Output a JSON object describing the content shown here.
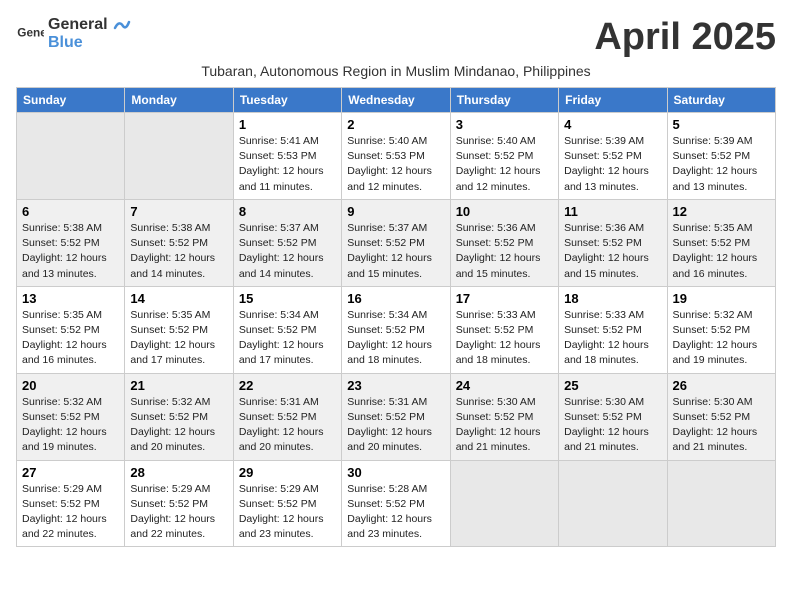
{
  "header": {
    "logo_general": "General",
    "logo_blue": "Blue",
    "month_title": "April 2025",
    "subtitle": "Tubaran, Autonomous Region in Muslim Mindanao, Philippines"
  },
  "weekdays": [
    "Sunday",
    "Monday",
    "Tuesday",
    "Wednesday",
    "Thursday",
    "Friday",
    "Saturday"
  ],
  "weeks": [
    [
      {
        "day": "",
        "info": ""
      },
      {
        "day": "",
        "info": ""
      },
      {
        "day": "1",
        "info": "Sunrise: 5:41 AM\nSunset: 5:53 PM\nDaylight: 12 hours and 11 minutes."
      },
      {
        "day": "2",
        "info": "Sunrise: 5:40 AM\nSunset: 5:53 PM\nDaylight: 12 hours and 12 minutes."
      },
      {
        "day": "3",
        "info": "Sunrise: 5:40 AM\nSunset: 5:52 PM\nDaylight: 12 hours and 12 minutes."
      },
      {
        "day": "4",
        "info": "Sunrise: 5:39 AM\nSunset: 5:52 PM\nDaylight: 12 hours and 13 minutes."
      },
      {
        "day": "5",
        "info": "Sunrise: 5:39 AM\nSunset: 5:52 PM\nDaylight: 12 hours and 13 minutes."
      }
    ],
    [
      {
        "day": "6",
        "info": "Sunrise: 5:38 AM\nSunset: 5:52 PM\nDaylight: 12 hours and 13 minutes."
      },
      {
        "day": "7",
        "info": "Sunrise: 5:38 AM\nSunset: 5:52 PM\nDaylight: 12 hours and 14 minutes."
      },
      {
        "day": "8",
        "info": "Sunrise: 5:37 AM\nSunset: 5:52 PM\nDaylight: 12 hours and 14 minutes."
      },
      {
        "day": "9",
        "info": "Sunrise: 5:37 AM\nSunset: 5:52 PM\nDaylight: 12 hours and 15 minutes."
      },
      {
        "day": "10",
        "info": "Sunrise: 5:36 AM\nSunset: 5:52 PM\nDaylight: 12 hours and 15 minutes."
      },
      {
        "day": "11",
        "info": "Sunrise: 5:36 AM\nSunset: 5:52 PM\nDaylight: 12 hours and 15 minutes."
      },
      {
        "day": "12",
        "info": "Sunrise: 5:35 AM\nSunset: 5:52 PM\nDaylight: 12 hours and 16 minutes."
      }
    ],
    [
      {
        "day": "13",
        "info": "Sunrise: 5:35 AM\nSunset: 5:52 PM\nDaylight: 12 hours and 16 minutes."
      },
      {
        "day": "14",
        "info": "Sunrise: 5:35 AM\nSunset: 5:52 PM\nDaylight: 12 hours and 17 minutes."
      },
      {
        "day": "15",
        "info": "Sunrise: 5:34 AM\nSunset: 5:52 PM\nDaylight: 12 hours and 17 minutes."
      },
      {
        "day": "16",
        "info": "Sunrise: 5:34 AM\nSunset: 5:52 PM\nDaylight: 12 hours and 18 minutes."
      },
      {
        "day": "17",
        "info": "Sunrise: 5:33 AM\nSunset: 5:52 PM\nDaylight: 12 hours and 18 minutes."
      },
      {
        "day": "18",
        "info": "Sunrise: 5:33 AM\nSunset: 5:52 PM\nDaylight: 12 hours and 18 minutes."
      },
      {
        "day": "19",
        "info": "Sunrise: 5:32 AM\nSunset: 5:52 PM\nDaylight: 12 hours and 19 minutes."
      }
    ],
    [
      {
        "day": "20",
        "info": "Sunrise: 5:32 AM\nSunset: 5:52 PM\nDaylight: 12 hours and 19 minutes."
      },
      {
        "day": "21",
        "info": "Sunrise: 5:32 AM\nSunset: 5:52 PM\nDaylight: 12 hours and 20 minutes."
      },
      {
        "day": "22",
        "info": "Sunrise: 5:31 AM\nSunset: 5:52 PM\nDaylight: 12 hours and 20 minutes."
      },
      {
        "day": "23",
        "info": "Sunrise: 5:31 AM\nSunset: 5:52 PM\nDaylight: 12 hours and 20 minutes."
      },
      {
        "day": "24",
        "info": "Sunrise: 5:30 AM\nSunset: 5:52 PM\nDaylight: 12 hours and 21 minutes."
      },
      {
        "day": "25",
        "info": "Sunrise: 5:30 AM\nSunset: 5:52 PM\nDaylight: 12 hours and 21 minutes."
      },
      {
        "day": "26",
        "info": "Sunrise: 5:30 AM\nSunset: 5:52 PM\nDaylight: 12 hours and 21 minutes."
      }
    ],
    [
      {
        "day": "27",
        "info": "Sunrise: 5:29 AM\nSunset: 5:52 PM\nDaylight: 12 hours and 22 minutes."
      },
      {
        "day": "28",
        "info": "Sunrise: 5:29 AM\nSunset: 5:52 PM\nDaylight: 12 hours and 22 minutes."
      },
      {
        "day": "29",
        "info": "Sunrise: 5:29 AM\nSunset: 5:52 PM\nDaylight: 12 hours and 23 minutes."
      },
      {
        "day": "30",
        "info": "Sunrise: 5:28 AM\nSunset: 5:52 PM\nDaylight: 12 hours and 23 minutes."
      },
      {
        "day": "",
        "info": ""
      },
      {
        "day": "",
        "info": ""
      },
      {
        "day": "",
        "info": ""
      }
    ]
  ]
}
